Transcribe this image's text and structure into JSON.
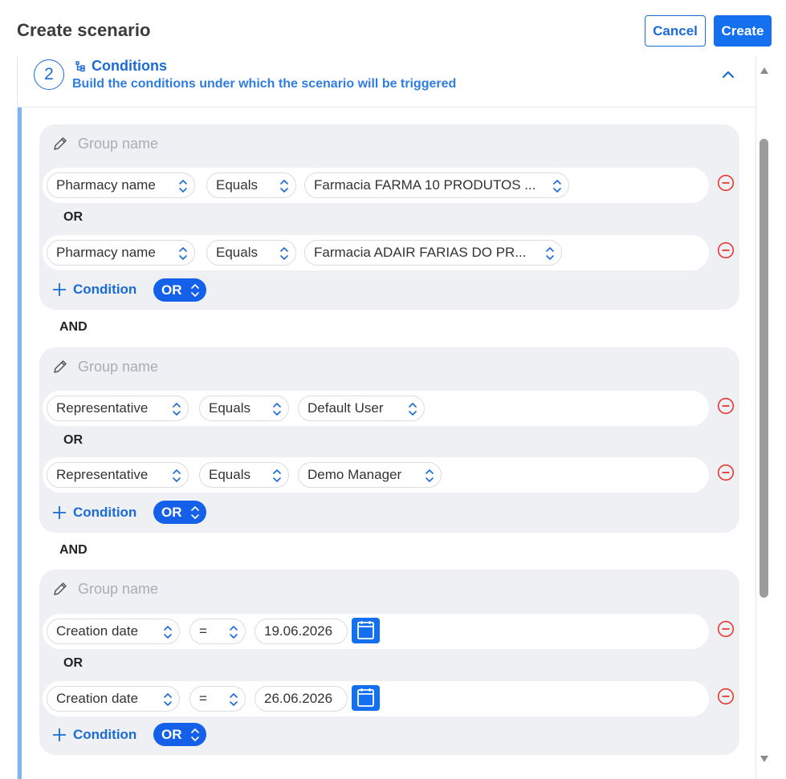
{
  "header": {
    "title": "Create scenario",
    "cancel_label": "Cancel",
    "create_label": "Create"
  },
  "step": {
    "number": "2",
    "title": "Conditions",
    "subtitle": "Build the conditions under which the scenario will be triggered"
  },
  "colors": {
    "accent": "#1a6bd6",
    "primary_button": "#1570ef",
    "remove_red": "#e53935",
    "group_bg": "#eef0f3",
    "left_bar": "#7eb3f5"
  },
  "groups": [
    {
      "name_placeholder": "Group name",
      "conditions": [
        {
          "field": "Pharmacy name",
          "operator": "Equals",
          "value": "Farmacia FARMA 10 PRODUTOS ..."
        },
        {
          "field": "Pharmacy name",
          "operator": "Equals",
          "value": "Farmacia ADAIR FARIAS DO PR..."
        }
      ],
      "joiner": "OR",
      "add_label": "Condition",
      "logic_toggle": "OR"
    },
    {
      "name_placeholder": "Group name",
      "conditions": [
        {
          "field": "Representative",
          "operator": "Equals",
          "value": "Default User"
        },
        {
          "field": "Representative",
          "operator": "Equals",
          "value": "Demo Manager"
        }
      ],
      "joiner": "OR",
      "add_label": "Condition",
      "logic_toggle": "OR"
    },
    {
      "name_placeholder": "Group name",
      "conditions": [
        {
          "field": "Creation date",
          "operator": "=",
          "value": "19.06.2026"
        },
        {
          "field": "Creation date",
          "operator": "=",
          "value": "26.06.2026"
        }
      ],
      "joiner": "OR",
      "add_label": "Condition",
      "logic_toggle": "OR"
    }
  ],
  "group_joiners": [
    "AND",
    "AND"
  ],
  "icons": {
    "group_edit": "pencil-icon",
    "remove": "minus-circle-icon",
    "add": "plus-icon",
    "select": "sort-chevrons-icon",
    "date": "calendar-icon",
    "collapse": "chevron-up-icon",
    "step_title": "conditions-tree-icon"
  }
}
